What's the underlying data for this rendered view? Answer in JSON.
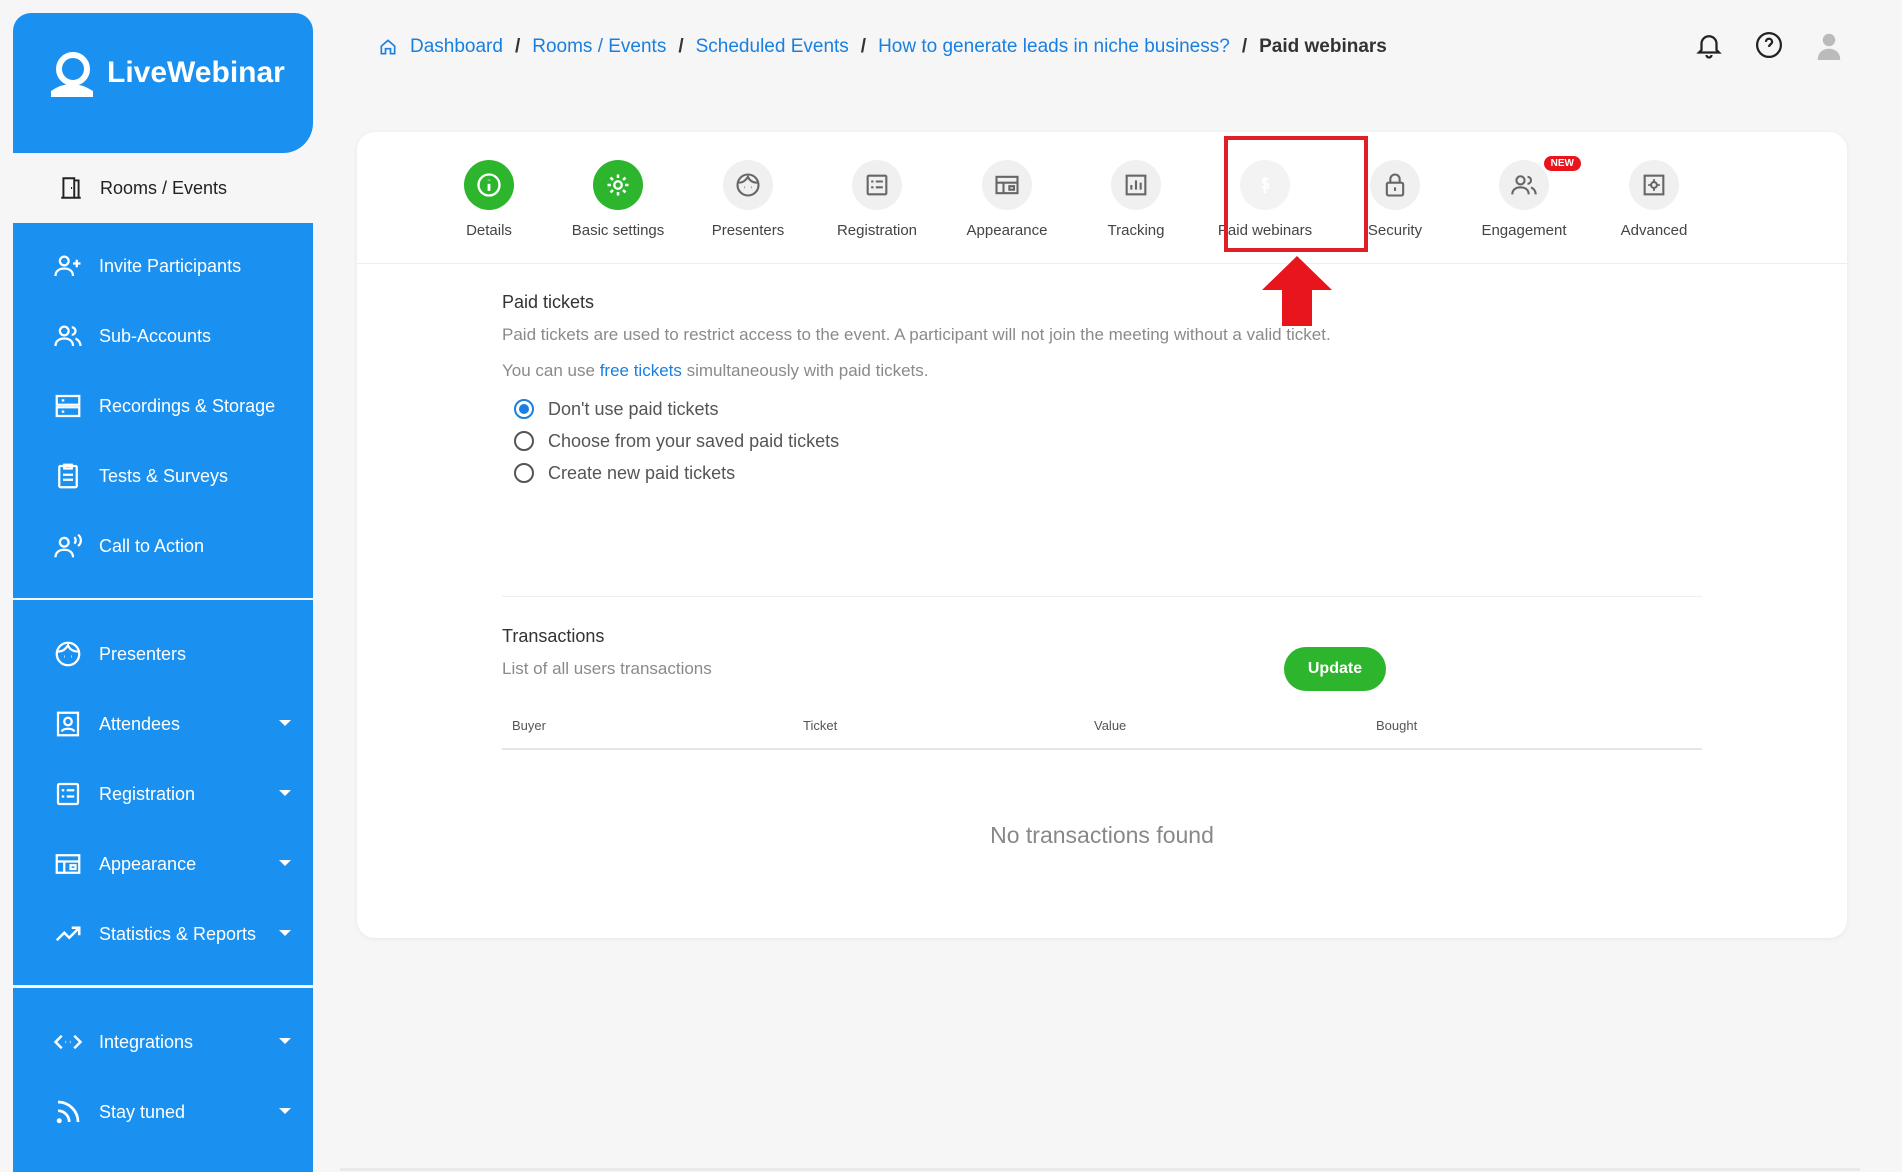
{
  "brand": {
    "name": "LiveWebinar"
  },
  "sidebar": {
    "active": {
      "label": "Rooms / Events"
    },
    "items": [
      {
        "label": "Invite Participants",
        "icon": "user-plus-icon"
      },
      {
        "label": "Sub-Accounts",
        "icon": "users-icon"
      },
      {
        "label": "Recordings & Storage",
        "icon": "server-icon"
      },
      {
        "label": "Tests & Surveys",
        "icon": "clipboard-icon"
      },
      {
        "label": "Call to Action",
        "icon": "speaking-user-icon"
      }
    ],
    "section2": [
      {
        "label": "Presenters",
        "icon": "presenter-face-icon"
      },
      {
        "label": "Attendees",
        "icon": "attendees-icon"
      },
      {
        "label": "Registration",
        "icon": "registration-form-icon"
      },
      {
        "label": "Appearance",
        "icon": "layout-icon"
      },
      {
        "label": "Statistics & Reports",
        "icon": "trend-up-icon"
      }
    ],
    "section3": [
      {
        "label": "Integrations",
        "icon": "code-arrows-icon"
      },
      {
        "label": "Stay tuned",
        "icon": "rss-icon"
      }
    ]
  },
  "breadcrumb": {
    "items": [
      "Dashboard",
      "Rooms / Events",
      "Scheduled Events",
      "How to generate leads in niche business?"
    ],
    "current": "Paid webinars",
    "separator": "/"
  },
  "tabs": [
    {
      "label": "Details"
    },
    {
      "label": "Basic settings"
    },
    {
      "label": "Presenters"
    },
    {
      "label": "Registration"
    },
    {
      "label": "Appearance"
    },
    {
      "label": "Tracking"
    },
    {
      "label": "Paid webinars"
    },
    {
      "label": "Security"
    },
    {
      "label": "Engagement",
      "badge": "NEW"
    },
    {
      "label": "Advanced"
    }
  ],
  "paid_tickets": {
    "title": "Paid tickets",
    "description": "Paid tickets are used to restrict access to the event. A participant will not join the meeting without a valid ticket.",
    "free_prefix": "You can use ",
    "free_link": "free tickets",
    "free_suffix": " simultaneously with paid tickets.",
    "options": [
      "Don't use paid tickets",
      "Choose from your saved paid tickets",
      "Create new paid tickets"
    ],
    "selected_index": 0,
    "update_label": "Update"
  },
  "transactions": {
    "title": "Transactions",
    "subtitle": "List of all users transactions",
    "columns": [
      "Buyer",
      "Ticket",
      "Value",
      "Bought"
    ],
    "empty": "No transactions found"
  },
  "colors": {
    "brand_blue": "#1a90f0",
    "green": "#2db52d",
    "highlight_red": "#e01e26",
    "link": "#1a7fe0"
  }
}
